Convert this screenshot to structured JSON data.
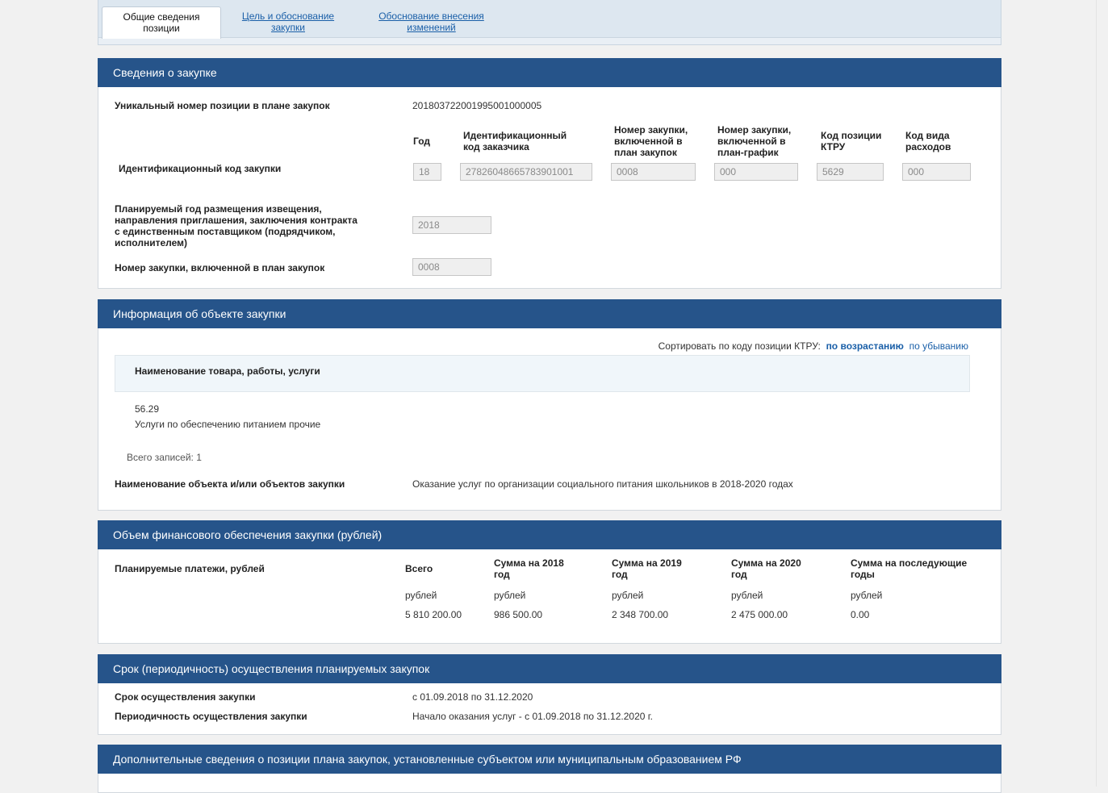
{
  "tabs": [
    {
      "label_line1": "Общие сведения",
      "label_line2": "позиции"
    },
    {
      "label_line1": "Цель и обоснование",
      "label_line2": "закупки"
    },
    {
      "label_line1": "Обоснование внесения",
      "label_line2": "изменений"
    }
  ],
  "section1": {
    "title": "Сведения о закупке",
    "unique_label": "Уникальный номер позиции в плане закупок",
    "unique_value": "20180372200199500100000​5",
    "id_code_label": "Идентификационный код закупки",
    "columns": [
      {
        "l1": "Год",
        "l2": "",
        "l3": "",
        "value": "18"
      },
      {
        "l1": "Идентификационный",
        "l2": "код заказчика",
        "l3": "",
        "value": "278260486657839010​01"
      },
      {
        "l1": "Номер закупки,",
        "l2": "включенной в",
        "l3": "план закупок",
        "value": "0008"
      },
      {
        "l1": "Номер закупки,",
        "l2": "включенной в",
        "l3": "план-график",
        "value": "000"
      },
      {
        "l1": "Код позиции",
        "l2": "КТРУ",
        "l3": "",
        "value": "5629"
      },
      {
        "l1": "Код вида",
        "l2": "расходов",
        "l3": "",
        "value": "000"
      }
    ],
    "planned_year_label": [
      "Планируемый год размещения извещения,",
      "направления приглашения, заключения контракта",
      "с единственным поставщиком (подрядчиком,",
      "исполнителем)"
    ],
    "planned_year_value": "2018",
    "plan_number_label": "Номер закупки, включенной в план закупок",
    "plan_number_value": "0008"
  },
  "section2": {
    "title": "Информация об объекте закупки",
    "sort_label": "Сортировать по коду позиции КТРУ:",
    "sort_asc": "по возрастанию",
    "sort_desc": "по убыванию",
    "table_header": "Наименование товара, работы, услуги",
    "item_code": "56.29",
    "item_name": "Услуги по обеспечению питанием прочие",
    "total_records": "Всего записей: 1",
    "object_label": "Наименование объекта и/или объектов закупки",
    "object_value": "Оказание услуг по организации социального питания школьников в 2018-2020 годах"
  },
  "section3": {
    "title": "Объем финансового обеспечения закупки (рублей)",
    "row_label": "Планируемые платежи, рублей",
    "columns": [
      {
        "l1": "Всего",
        "l2": "",
        "unit": "рублей",
        "value": "5 810 200.00"
      },
      {
        "l1": "Сумма на 2018",
        "l2": "год",
        "unit": "рублей",
        "value": "986 500.00"
      },
      {
        "l1": "Сумма на 2019",
        "l2": "год",
        "unit": "рублей",
        "value": "2 348 700.00"
      },
      {
        "l1": "Сумма на 2020",
        "l2": "год",
        "unit": "рублей",
        "value": "2 475 000.00"
      },
      {
        "l1": "Сумма на последующие",
        "l2": "годы",
        "unit": "рублей",
        "value": "0.00"
      }
    ]
  },
  "section4": {
    "title": "Срок (периодичность) осуществления планируемых закупок",
    "term_label": "Срок осуществления закупки",
    "term_value": "с 01.09.2018 по 31.12.2020",
    "period_label": "Периодичность осуществления закупки",
    "period_value": "Начало оказания услуг - с 01.09.2018 по 31.12.2020 г."
  },
  "section5": {
    "title": "Дополнительные сведения о позиции плана закупок, установленные субъектом или муниципальным образованием РФ"
  }
}
